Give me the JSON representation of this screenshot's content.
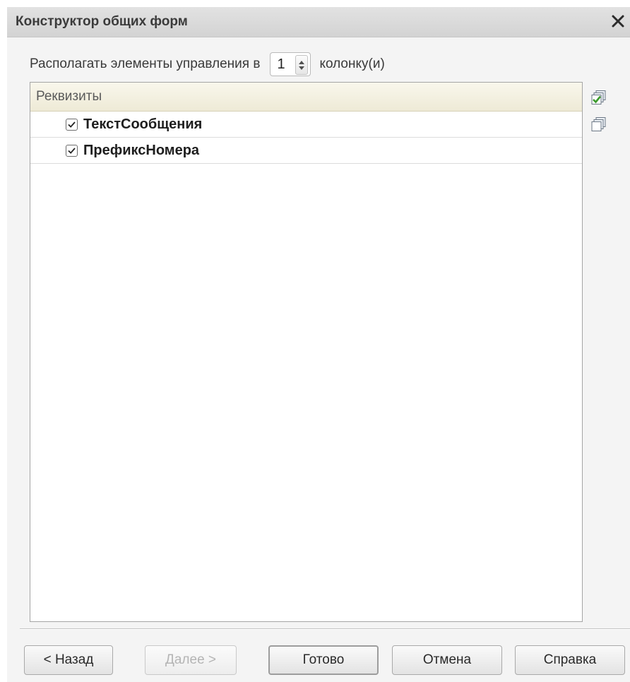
{
  "window": {
    "title": "Конструктор общих форм",
    "close_icon": "close-icon"
  },
  "columns_setting": {
    "label_before": "Располагать элементы управления в",
    "value": "1",
    "label_after": "колонку(и)"
  },
  "list": {
    "header": "Реквизиты",
    "items": [
      {
        "label": "ТекстСообщения",
        "checked": true
      },
      {
        "label": "ПрефиксНомера",
        "checked": true
      }
    ]
  },
  "side_buttons": {
    "check_all_icon": "check-all-icon",
    "uncheck_all_icon": "uncheck-all-icon"
  },
  "footer": {
    "back_label": "< Назад",
    "next_label": "Далее >",
    "finish_label": "Готово",
    "cancel_label": "Отмена",
    "help_label": "Справка"
  },
  "colors": {
    "title_bar": "#d8d8d8",
    "dialog_bg": "#f4f4f4",
    "header_bg": "#f3f0e1",
    "check_green": "#3b9a2c"
  }
}
